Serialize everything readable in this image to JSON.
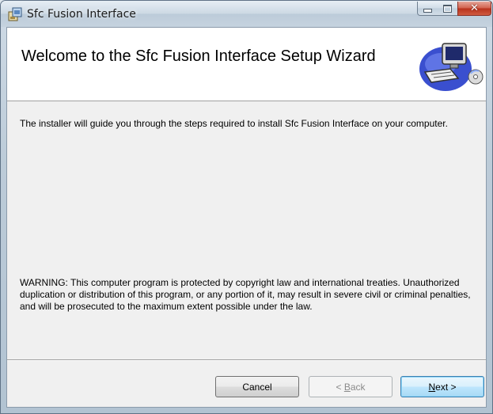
{
  "window": {
    "title": "Sfc Fusion Interface",
    "controls": {
      "minimize": "minimize-icon",
      "maximize": "maximize-icon",
      "close": "close-icon"
    }
  },
  "banner": {
    "title": "Welcome to the Sfc Fusion Interface Setup Wizard",
    "art_icon": "computer-setup-icon"
  },
  "body": {
    "intro": "The installer will guide you through the steps required to install Sfc Fusion Interface on your computer.",
    "warning": "WARNING: This computer program is protected by copyright law and international treaties. Unauthorized duplication or distribution of this program, or any portion of it, may result in severe civil or criminal penalties, and will be prosecuted to the maximum extent possible under the law."
  },
  "buttons": {
    "cancel": {
      "label": "Cancel",
      "enabled": true
    },
    "back": {
      "prefix": "< ",
      "mnemonic": "B",
      "rest": "ack",
      "enabled": false
    },
    "next": {
      "mnemonic": "N",
      "rest": "ext >",
      "enabled": true,
      "default": true
    }
  },
  "colors": {
    "close_button": "#c7432b",
    "default_button_border": "#3c7fb1",
    "dialog_background": "#f0f0f0"
  }
}
